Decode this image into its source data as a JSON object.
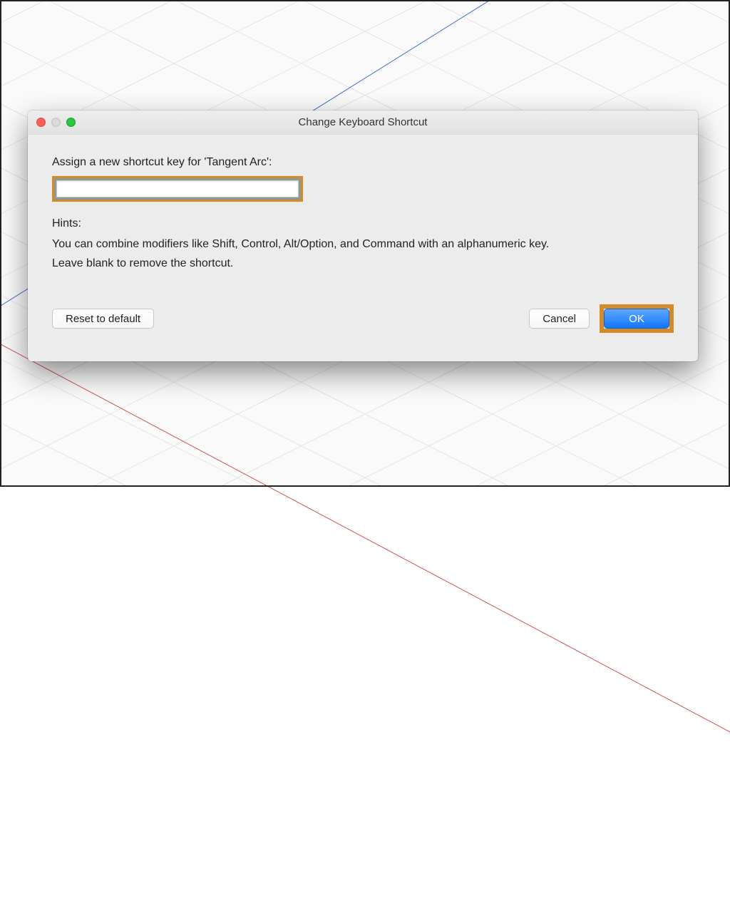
{
  "dialog": {
    "title": "Change Keyboard Shortcut",
    "assign_label": "Assign a new shortcut key for 'Tangent Arc':",
    "shortcut_value": "",
    "hints_label": "Hints:",
    "hints_line1": "You can combine modifiers like Shift, Control, Alt/Option, and Command with an alphanumeric key.",
    "hints_line2": "Leave blank to remove the shortcut.",
    "buttons": {
      "reset": "Reset to default",
      "cancel": "Cancel",
      "ok": "OK"
    }
  },
  "highlight_color": "#d48a27",
  "primary_color": "#1276ff"
}
